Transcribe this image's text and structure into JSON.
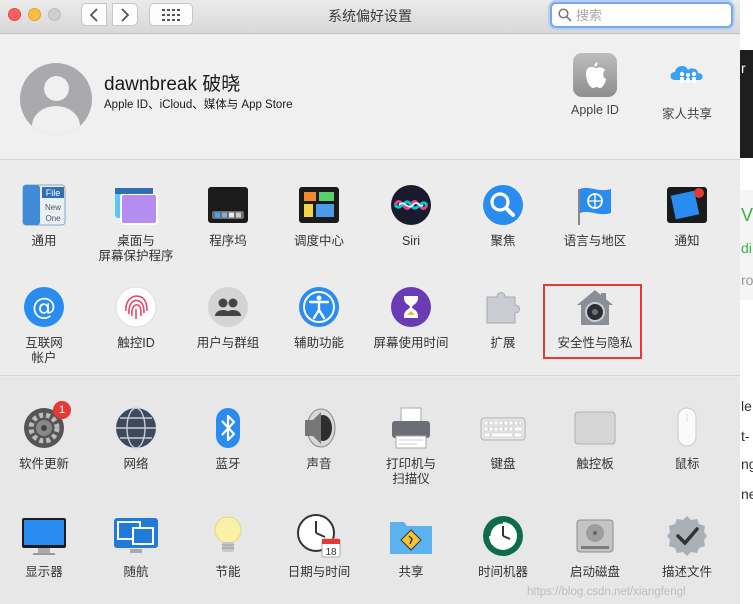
{
  "window": {
    "title": "系统偏好设置"
  },
  "search": {
    "placeholder": "搜索"
  },
  "account": {
    "name": "dawnbreak 破晓",
    "subtitle": "Apple ID、iCloud、媒体与 App Store",
    "apple_id_label": "Apple ID",
    "family_label": "家人共享"
  },
  "row1": [
    {
      "label": "通用"
    },
    {
      "label": "桌面与\n屏幕保护程序"
    },
    {
      "label": "程序坞"
    },
    {
      "label": "调度中心"
    },
    {
      "label": "Siri"
    },
    {
      "label": "聚焦"
    },
    {
      "label": "语言与地区"
    },
    {
      "label": "通知"
    }
  ],
  "row2": [
    {
      "label": "互联网\n帐户"
    },
    {
      "label": "触控ID"
    },
    {
      "label": "用户与群组"
    },
    {
      "label": "辅助功能"
    },
    {
      "label": "屏幕使用时间"
    },
    {
      "label": "扩展"
    },
    {
      "label": "安全性与隐私"
    }
  ],
  "row3": [
    {
      "label": "软件更新",
      "badge": "1"
    },
    {
      "label": "网络"
    },
    {
      "label": "蓝牙"
    },
    {
      "label": "声音"
    },
    {
      "label": "打印机与\n扫描仪"
    },
    {
      "label": "键盘"
    },
    {
      "label": "触控板"
    },
    {
      "label": "鼠标"
    }
  ],
  "row4": [
    {
      "label": "显示器"
    },
    {
      "label": "随航"
    },
    {
      "label": "节能"
    },
    {
      "label": "日期与时间",
      "calendar_day": "18"
    },
    {
      "label": "共享"
    },
    {
      "label": "时间机器"
    },
    {
      "label": "启动磁盘"
    },
    {
      "label": "描述文件"
    }
  ],
  "general_icon_text": [
    "File",
    "New",
    "One"
  ],
  "watermark": "https://blog.csdn.net/xiangfengl",
  "behind_window_glyphs": [
    "r",
    "V",
    "di",
    "ro",
    "le",
    "t-",
    "ng",
    "ne"
  ],
  "colors": {
    "highlight": "#e53935",
    "badge": "#e53935",
    "accent": "#1f8ef1"
  }
}
